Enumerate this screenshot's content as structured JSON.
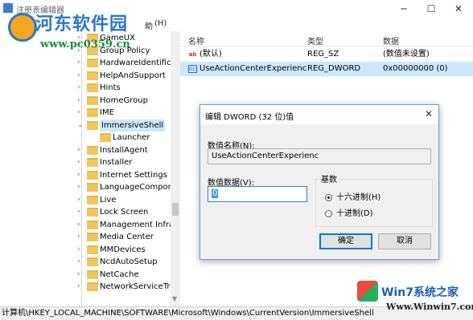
{
  "window": {
    "title": "注册表编辑器",
    "controls": {
      "minimize": "─",
      "maximize": "☐",
      "close": "✕"
    }
  },
  "menu": {
    "visible": [
      "助"
    ],
    "hint": "(H)"
  },
  "watermark_top": {
    "brand": "河东软件园",
    "url": "www.pc0359.cn"
  },
  "tree": {
    "items": [
      {
        "label": "GameUX",
        "expandable": true
      },
      {
        "label": "Group Policy",
        "expandable": true
      },
      {
        "label": "HardwareIdentificat",
        "expandable": true
      },
      {
        "label": "HelpAndSupport",
        "expandable": true
      },
      {
        "label": "Hints",
        "expandable": true
      },
      {
        "label": "HomeGroup",
        "expandable": true
      },
      {
        "label": "IME",
        "expandable": true
      },
      {
        "label": "ImmersiveShell",
        "expandable": true,
        "expanded": true,
        "selected": true
      },
      {
        "label": "Launcher",
        "expandable": false,
        "child": true
      },
      {
        "label": "InstallAgent",
        "expandable": true
      },
      {
        "label": "Installer",
        "expandable": true
      },
      {
        "label": "Internet Settings",
        "expandable": true
      },
      {
        "label": "LanguageCompone",
        "expandable": true
      },
      {
        "label": "Live",
        "expandable": true
      },
      {
        "label": "Lock Screen",
        "expandable": true
      },
      {
        "label": "Management Infras",
        "expandable": true
      },
      {
        "label": "Media Center",
        "expandable": true
      },
      {
        "label": "MMDevices",
        "expandable": true
      },
      {
        "label": "NcdAutoSetup",
        "expandable": true
      },
      {
        "label": "NetCache",
        "expandable": true
      },
      {
        "label": "NetworkServiceTrig",
        "expandable": true
      }
    ]
  },
  "list": {
    "headers": {
      "name": "名称",
      "type": "类型",
      "data": "数据"
    },
    "rows": [
      {
        "icon": "ab",
        "name": "(默认)",
        "type": "REG_SZ",
        "data": "(数值未设置)",
        "selected": false
      },
      {
        "icon": "binary",
        "name": "UseActionCenterExperienc",
        "type": "REG_DWORD",
        "data": "0x00000000 (0)",
        "selected": true
      }
    ]
  },
  "statusbar": {
    "path": "计算机\\HKEY_LOCAL_MACHINE\\SOFTWARE\\Microsoft\\Windows\\CurrentVersion\\ImmersiveShell"
  },
  "dialog": {
    "title": "编辑 DWORD (32 位)值",
    "close": "✕",
    "value_name_label": "数值名称(N):",
    "value_name": "UseActionCenterExperienc",
    "value_data_label": "数值数据(V):",
    "value_data": "0",
    "base_label": "基数",
    "base_options": [
      {
        "label": "十六进制(H)",
        "selected": true
      },
      {
        "label": "十进制(D)",
        "selected": false
      }
    ],
    "ok": "确定",
    "cancel": "取消"
  },
  "watermark_bottom": {
    "brand": "Win7系统之家",
    "url": "Www.Winwin7.com"
  }
}
